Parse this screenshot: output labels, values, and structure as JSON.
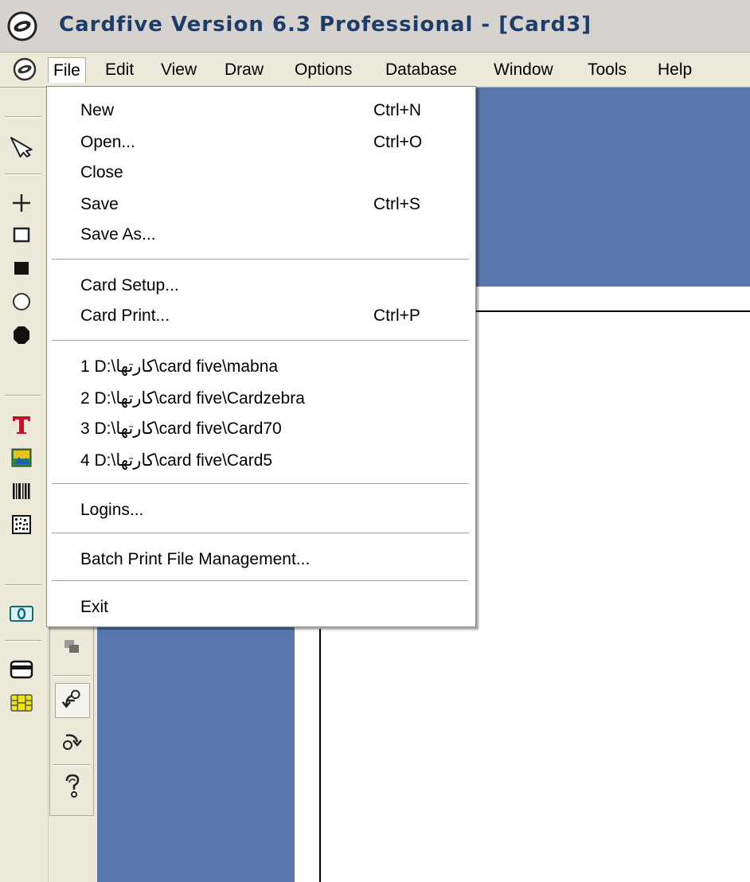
{
  "window": {
    "title": "Cardfive Version 6.3 Professional - [Card3]"
  },
  "menubar": {
    "items": [
      {
        "label": "File"
      },
      {
        "label": "Edit"
      },
      {
        "label": "View"
      },
      {
        "label": "Draw"
      },
      {
        "label": "Options"
      },
      {
        "label": "Database"
      },
      {
        "label": "Window"
      },
      {
        "label": "Tools"
      },
      {
        "label": "Help"
      }
    ],
    "active": "File"
  },
  "file_menu": {
    "groups": [
      [
        {
          "label": "New",
          "shortcut": "Ctrl+N"
        },
        {
          "label": "Open...",
          "shortcut": "Ctrl+O"
        },
        {
          "label": "Close",
          "shortcut": ""
        },
        {
          "label": "Save",
          "shortcut": "Ctrl+S"
        },
        {
          "label": "Save As...",
          "shortcut": ""
        }
      ],
      [
        {
          "label": "Card Setup...",
          "shortcut": ""
        },
        {
          "label": "Card Print...",
          "shortcut": "Ctrl+P"
        }
      ],
      [
        {
          "label": "1 D:\\کارتها\\card five\\mabna",
          "shortcut": ""
        },
        {
          "label": "2 D:\\کارتها\\card five\\Cardzebra",
          "shortcut": ""
        },
        {
          "label": "3 D:\\کارتها\\card five\\Card70",
          "shortcut": ""
        },
        {
          "label": "4 D:\\کارتها\\card five\\Card5",
          "shortcut": ""
        }
      ],
      [
        {
          "label": "Logins...",
          "shortcut": ""
        }
      ],
      [
        {
          "label": "Batch Print File Management...",
          "shortcut": ""
        }
      ],
      [
        {
          "label": "Exit",
          "shortcut": ""
        }
      ]
    ]
  },
  "toolbar": {
    "tools": [
      "select-arrow-icon",
      "crosshair-icon",
      "rectangle-outline-icon",
      "rectangle-filled-icon",
      "ellipse-outline-icon",
      "ellipse-filled-icon",
      "text-tool-icon",
      "image-tool-icon",
      "barcode-icon",
      "2d-barcode-icon",
      "numbering-field-icon",
      "magnetic-stripe-icon",
      "smart-chip-icon"
    ],
    "secondary_tools": [
      "layer-stack-icon",
      "rotate-left-icon",
      "rotate-right-icon",
      "help-icon"
    ]
  },
  "colors": {
    "canvas_blue": "#5877ad",
    "title_text": "#1e3c68",
    "menu_background": "#ece9d8"
  }
}
